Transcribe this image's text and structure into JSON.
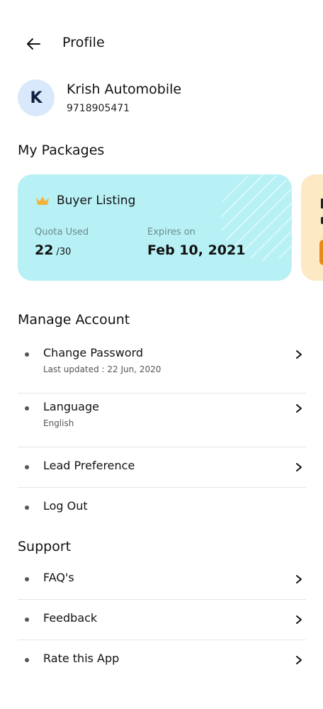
{
  "header": {
    "title": "Profile",
    "back_icon": "arrow-left-icon"
  },
  "profile": {
    "initial": "K",
    "name": "Krish Automobile",
    "phone": "9718905471"
  },
  "packages": {
    "section_title": "My Packages",
    "cards": [
      {
        "name": "Buyer Listing",
        "icon": "crown-icon",
        "quota_label": "Quota Used",
        "quota_used": "22",
        "quota_total": "/30",
        "expiry_label": "Expires on",
        "expiry_value": "Feb 10, 2021",
        "color": "#b8f1f5"
      },
      {
        "color": "#fde9c4",
        "accent": "#e68a1d"
      }
    ]
  },
  "manage_account": {
    "section_title": "Manage Account",
    "items": [
      {
        "label": "Change Password",
        "sub": "Last updated : 22 Jun, 2020"
      },
      {
        "label": "Language",
        "sub": "English"
      },
      {
        "label": "Lead Preference"
      },
      {
        "label": "Log Out"
      }
    ]
  },
  "support": {
    "section_title": "Support",
    "items": [
      {
        "label": "FAQ's"
      },
      {
        "label": "Feedback"
      },
      {
        "label": "Rate this App"
      }
    ]
  },
  "colors": {
    "avatar_bg": "#d9e9fb",
    "crown": "#f2b33d",
    "divider": "#e6e6e6"
  }
}
